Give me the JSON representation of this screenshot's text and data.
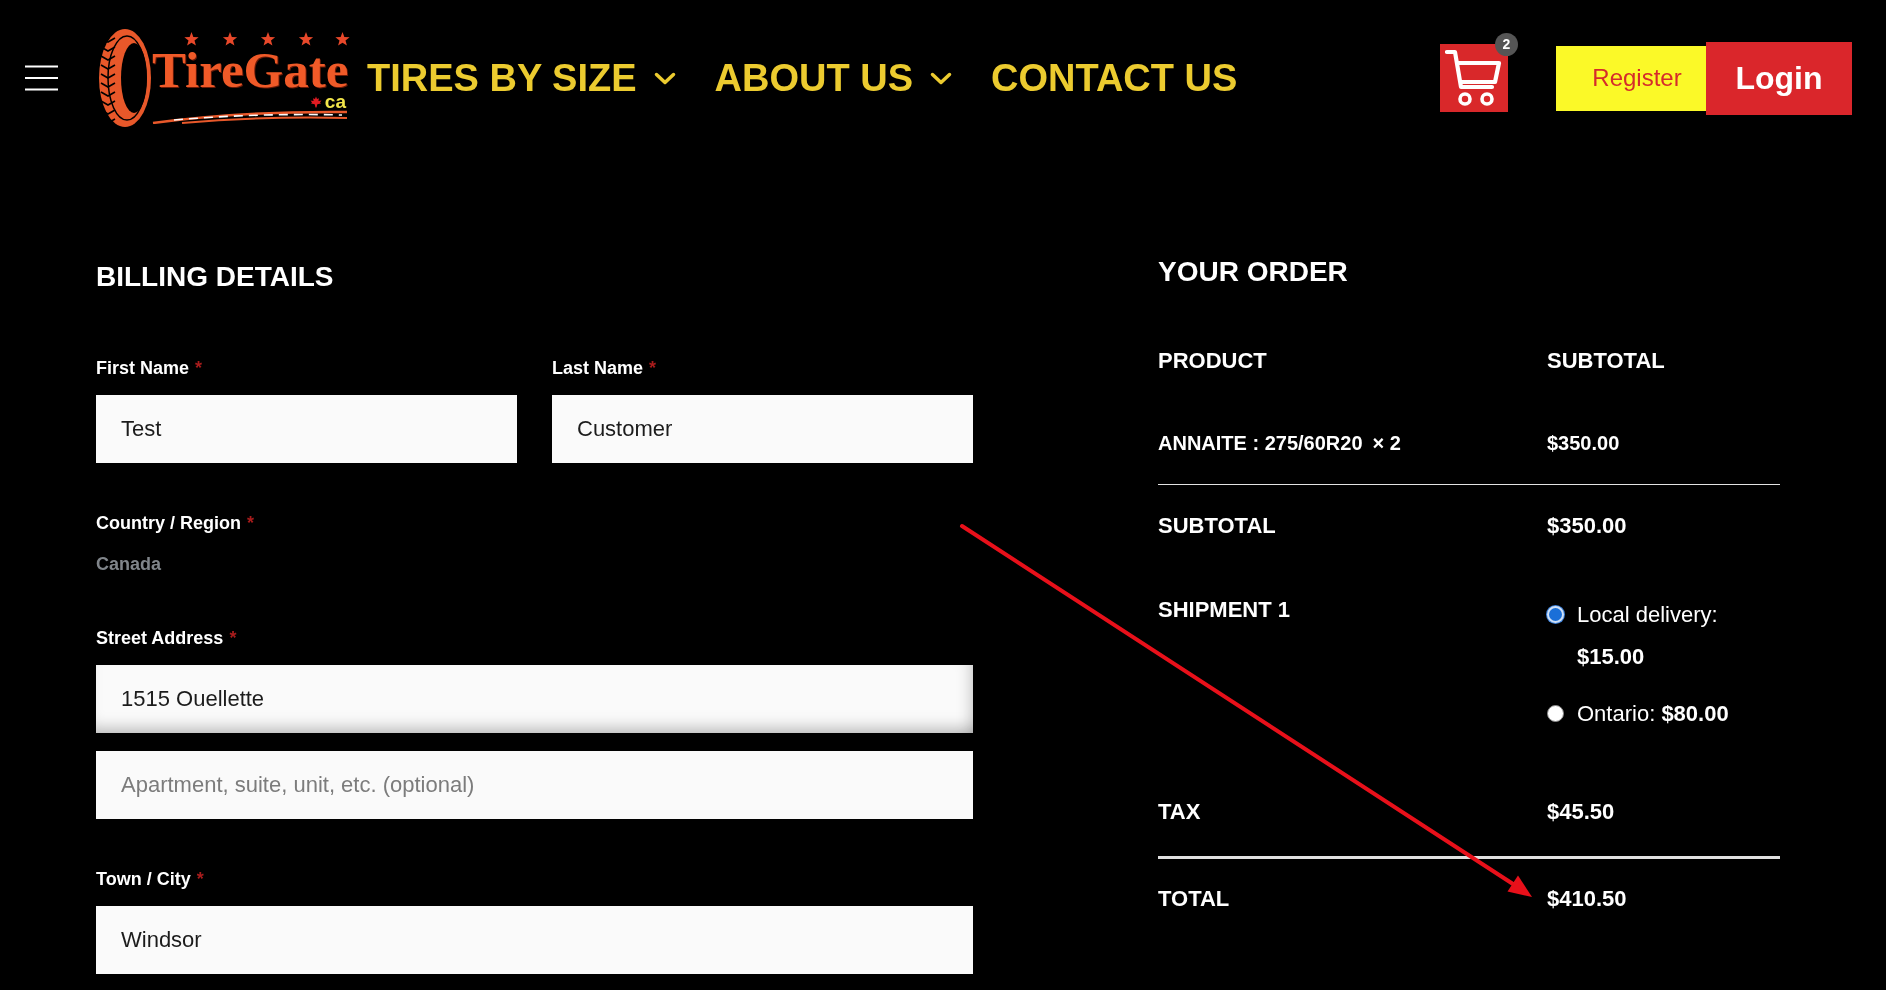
{
  "header": {
    "logo": {
      "wordmark": "TireGate",
      "domain": "ca"
    },
    "nav": [
      {
        "label": "TIRES BY SIZE",
        "has_dropdown": true
      },
      {
        "label": "ABOUT US",
        "has_dropdown": true
      },
      {
        "label": "CONTACT US",
        "has_dropdown": false
      }
    ],
    "cart": {
      "count": "2"
    },
    "buttons": [
      {
        "label": "Register",
        "kind": "secondary"
      },
      {
        "label": "Login",
        "kind": "primary"
      }
    ]
  },
  "billing": {
    "title": "BILLING DETAILS",
    "rows": [
      {
        "fields": [
          {
            "label": "First Name",
            "required_mark": "*",
            "kind": "input",
            "inputs": [
              {
                "value": "Test",
                "focused": false
              }
            ]
          },
          {
            "label": "Last Name",
            "required_mark": "*",
            "kind": "input",
            "inputs": [
              {
                "value": "Customer",
                "focused": false
              }
            ]
          }
        ]
      },
      {
        "fields": [
          {
            "label": "Country / Region",
            "required_mark": "*",
            "kind": "static",
            "value": "Canada"
          }
        ]
      },
      {
        "fields": [
          {
            "label": "Street Address",
            "required_mark": "*",
            "kind": "input",
            "inputs": [
              {
                "value": "1515 Ouellette",
                "focused": true
              },
              {
                "placeholder": "Apartment, suite, unit, etc. (optional)",
                "focused": false
              }
            ]
          }
        ]
      },
      {
        "fields": [
          {
            "label": "Town / City",
            "required_mark": "*",
            "kind": "input",
            "inputs": [
              {
                "value": "Windsor",
                "focused": false
              }
            ]
          }
        ]
      }
    ]
  },
  "order": {
    "title": "YOUR ORDER",
    "columns": [
      "PRODUCT",
      "SUBTOTAL"
    ],
    "items": [
      {
        "name": "ANNAITE : 275/60R20",
        "quantity": "× 2",
        "subtotal": "$350.00"
      }
    ],
    "summary": [
      {
        "kind": "subtotal",
        "label": "SUBTOTAL",
        "value": "$350.00"
      },
      {
        "kind": "shipping",
        "label": "SHIPMENT 1",
        "options": [
          {
            "label": "Local delivery: **$15.00**",
            "selected": true
          },
          {
            "label": "Ontario: **$80.00**",
            "selected": false
          }
        ]
      },
      {
        "kind": "tax",
        "label": "TAX",
        "value": "$45.50"
      },
      {
        "kind": "total",
        "label": "TOTAL",
        "value": "$410.50"
      }
    ]
  },
  "annotations": [
    {
      "kind": "arrow"
    }
  ]
}
